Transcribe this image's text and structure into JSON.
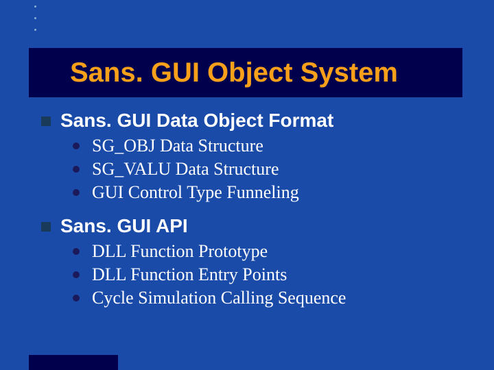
{
  "title": "Sans. GUI Object System",
  "sections": [
    {
      "heading": "Sans. GUI Data Object Format",
      "items": [
        "SG_OBJ Data Structure",
        "SG_VALU Data Structure",
        "GUI Control Type Funneling"
      ]
    },
    {
      "heading": "Sans. GUI API",
      "items": [
        "DLL Function Prototype",
        "DLL Function Entry Points",
        "Cycle Simulation Calling Sequence"
      ]
    }
  ]
}
